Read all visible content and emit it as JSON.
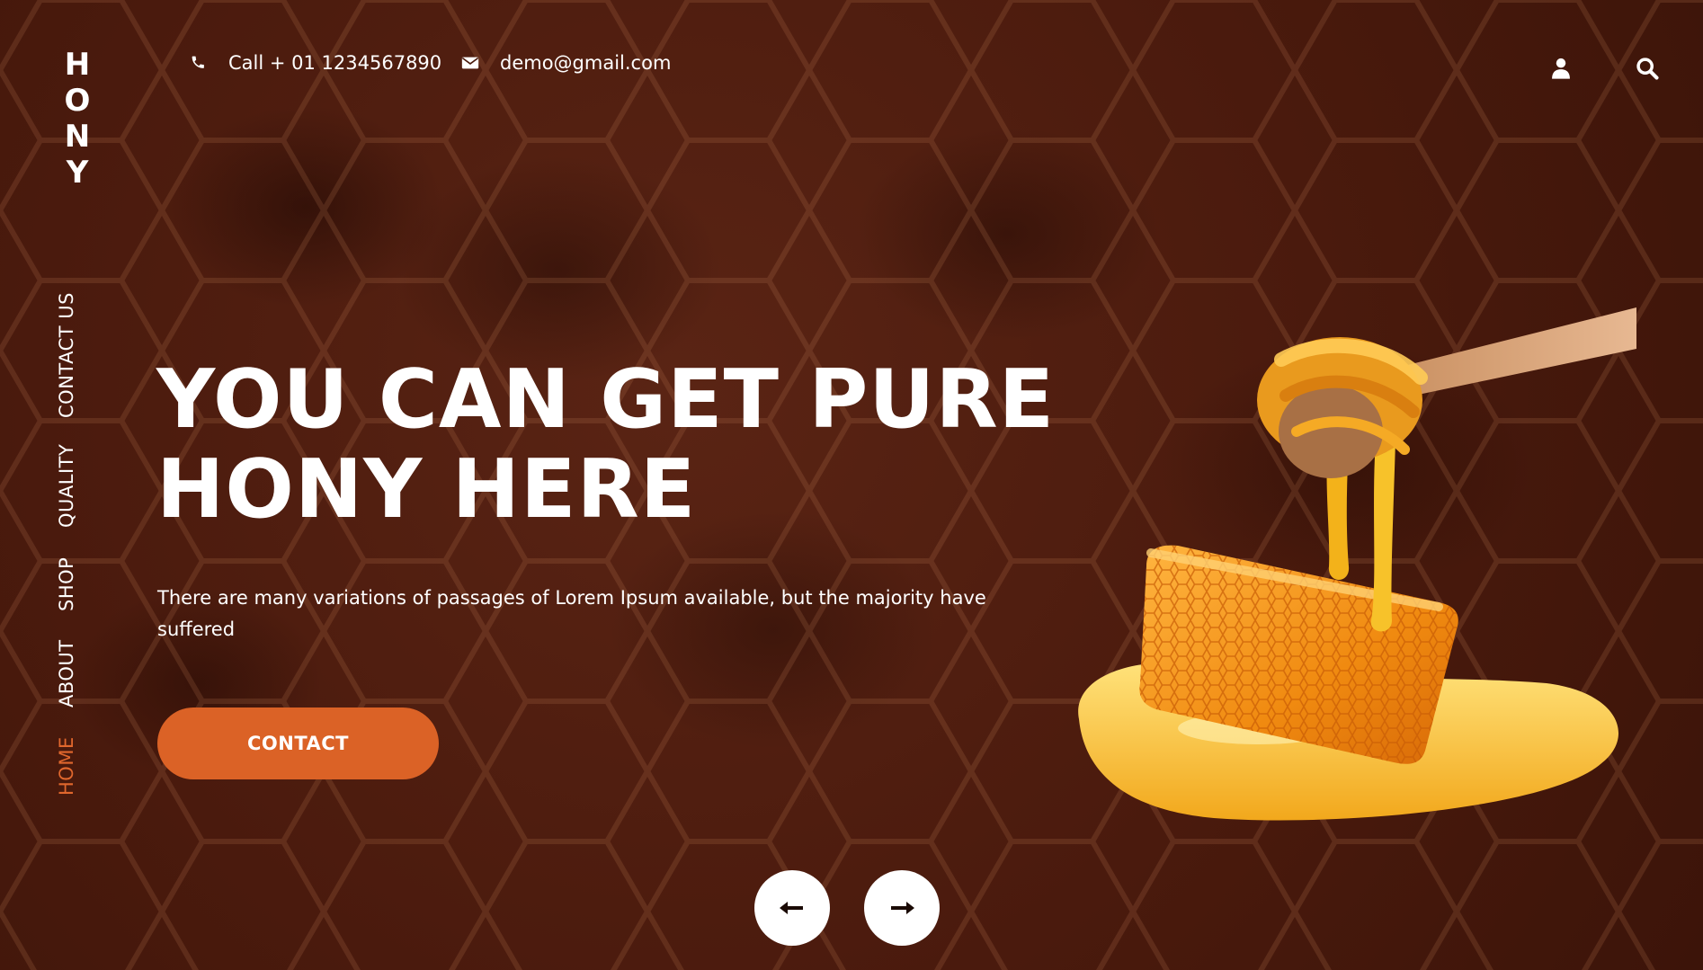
{
  "brand": {
    "logo_letters": [
      "H",
      "O",
      "N",
      "Y"
    ]
  },
  "topbar": {
    "phone_text": "Call + 01 1234567890",
    "email_text": "demo@gmail.com",
    "phone_icon": "phone-icon",
    "email_icon": "envelope-icon",
    "user_icon": "user-icon",
    "search_icon": "search-icon"
  },
  "nav": {
    "items": [
      {
        "label": "CONTACT US",
        "active": false
      },
      {
        "label": "QUALITY",
        "active": false
      },
      {
        "label": "SHOP",
        "active": false
      },
      {
        "label": "ABOUT",
        "active": false
      },
      {
        "label": "HOME",
        "active": true
      }
    ]
  },
  "hero": {
    "title_line1": "YOU CAN GET PURE",
    "title_line2": "HONY HERE",
    "description": "There are many variations of passages of Lorem Ipsum available, but the majority have suffered",
    "cta_label": "CONTACT"
  },
  "carousel": {
    "prev_icon": "arrow-left-icon",
    "next_icon": "arrow-right-icon"
  },
  "colors": {
    "background": "#4a1a0d",
    "accent": "#db6226",
    "active_nav": "#e0672d",
    "text": "#ffffff"
  }
}
